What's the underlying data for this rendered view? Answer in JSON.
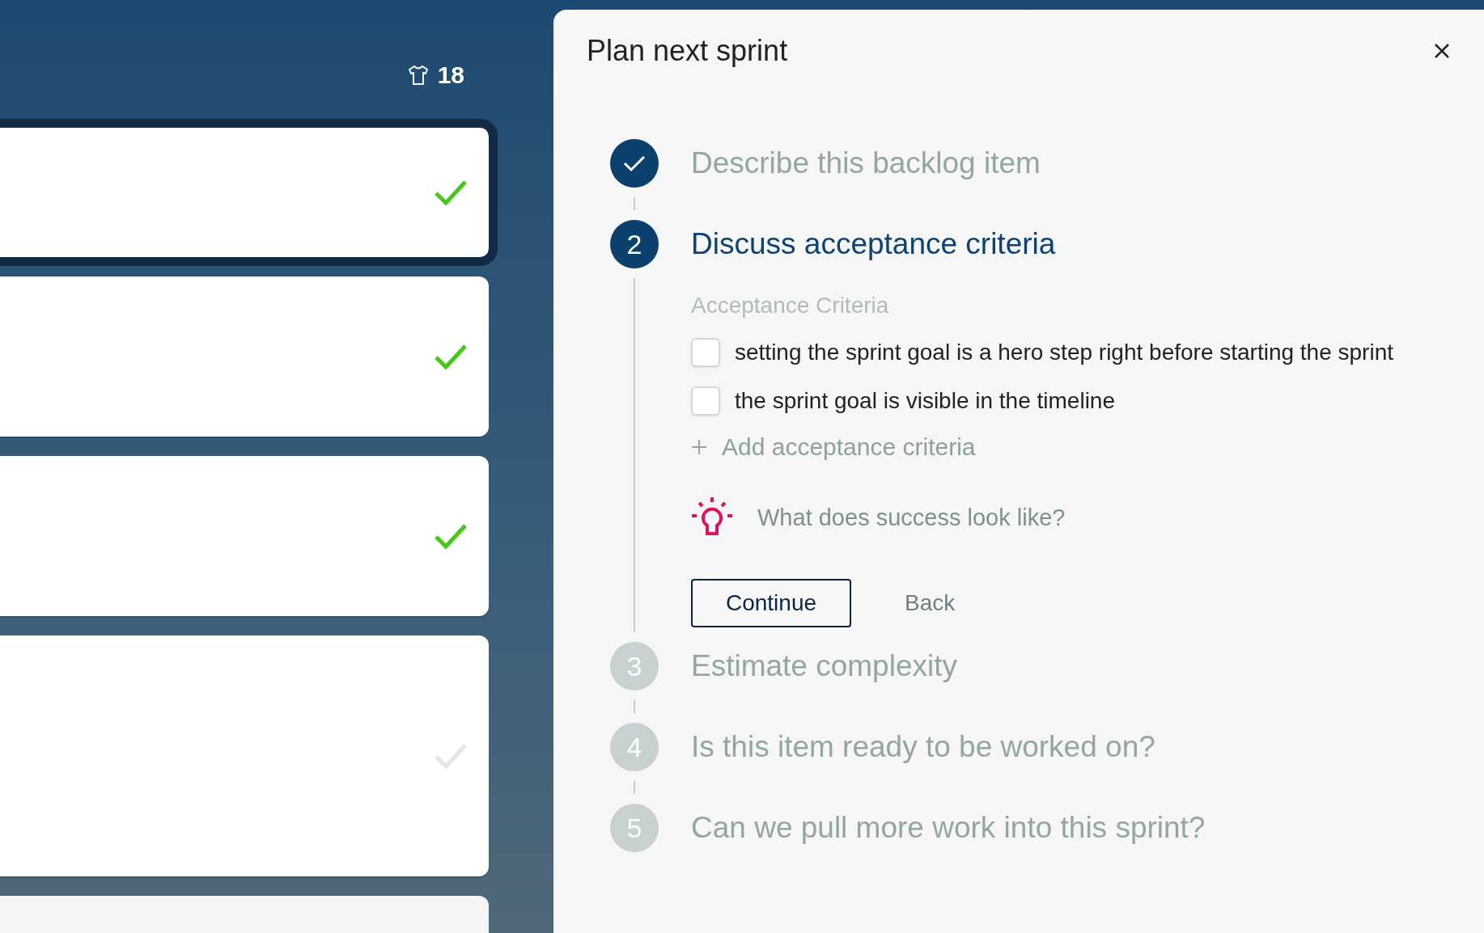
{
  "board": {
    "points": "18",
    "cards": [
      {
        "selected": true,
        "done": true
      },
      {
        "selected": false,
        "done": true
      },
      {
        "selected": false,
        "done": true
      },
      {
        "selected": false,
        "done": false
      },
      {
        "selected": false
      }
    ]
  },
  "panel": {
    "title": "Plan next sprint",
    "steps": [
      {
        "kind": "done",
        "title": "Describe this backlog item"
      },
      {
        "kind": "active",
        "number": "2",
        "title": "Discuss acceptance criteria",
        "content": {
          "label": "Acceptance Criteria",
          "criteria": [
            {
              "text": "setting the sprint goal is a hero step right before starting the sprint",
              "checked": false
            },
            {
              "text": "the sprint goal is visible in the timeline",
              "checked": false
            }
          ],
          "add_link": "Add acceptance criteria",
          "hint": "What does success look like?",
          "buttons": [
            {
              "label": "Continue",
              "kind": "primary"
            },
            {
              "label": "Back",
              "kind": "link"
            }
          ]
        }
      },
      {
        "kind": "pending",
        "number": "3",
        "title": "Estimate complexity"
      },
      {
        "kind": "pending",
        "number": "4",
        "title": "Is this item ready to be worked on?"
      },
      {
        "kind": "pending",
        "number": "5",
        "title": "Can we pull more work into this sprint?"
      }
    ]
  }
}
